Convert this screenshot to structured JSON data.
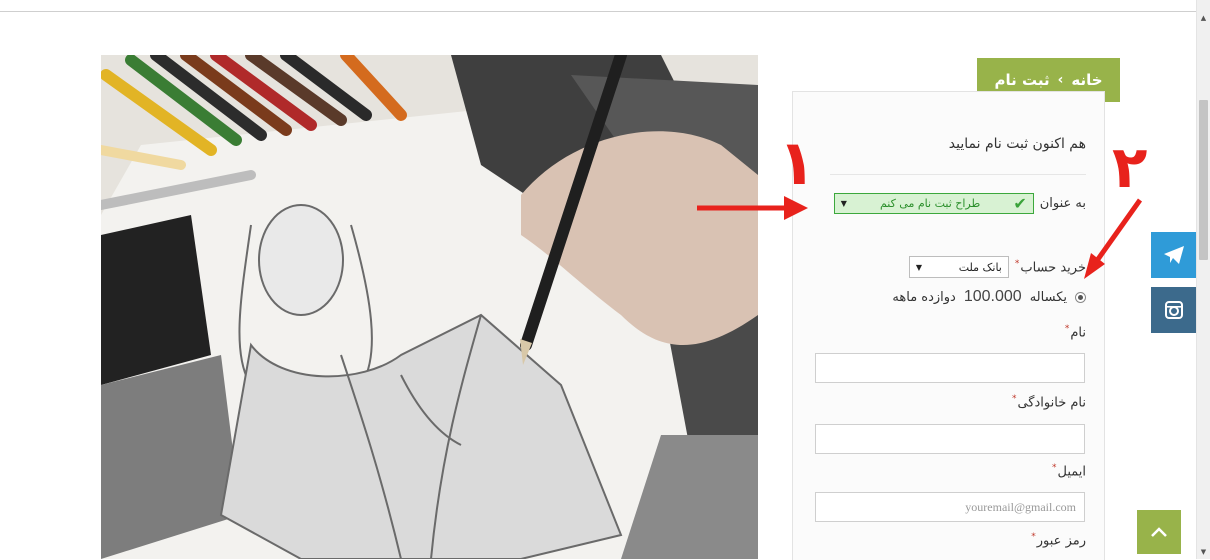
{
  "breadcrumb": {
    "home": "خانه",
    "separator": "›",
    "current": "ثبت نام"
  },
  "form": {
    "title": "هم اکنون ثبت نام نمایید",
    "role_label": "به عنوان",
    "role_selected": "طراح ثبت نام می کنم",
    "buy_label": "خرید حساب",
    "bank_selected": "بانک ملت",
    "plan_period": "یکساله",
    "plan_price": "100.000",
    "plan_note": "دوازده ماهه",
    "first_name_label": "نام",
    "last_name_label": "نام خانوادگی",
    "email_label": "ایمیل",
    "email_placeholder": "youremail@gmail.com",
    "password_label": "رمز عبور",
    "required_mark": "*"
  },
  "annotations": {
    "one": "۱",
    "two": "۲"
  },
  "colors": {
    "accent": "#98b34a",
    "telegram": "#2f9bd8",
    "instagram": "#3c6a8c",
    "annotation": "#e8221c",
    "role_select_bg": "#d8f2d3"
  },
  "icons": {
    "telegram": "paper-plane-icon",
    "instagram": "instagram-icon",
    "back_to_top": "chevron-up-icon",
    "role_check": "checkmark-icon"
  }
}
